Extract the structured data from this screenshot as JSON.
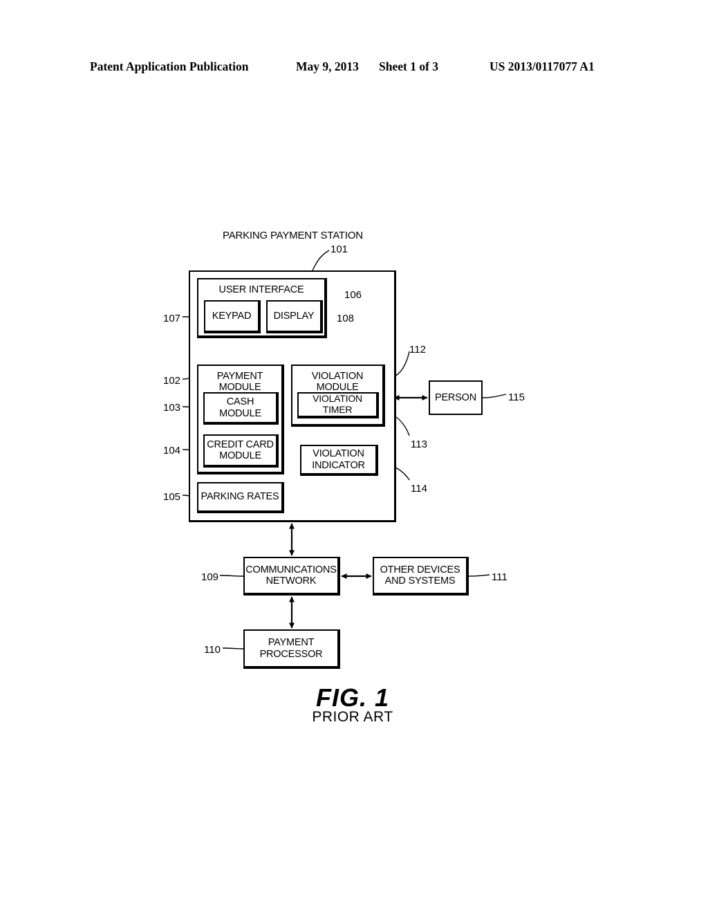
{
  "header": {
    "publication": "Patent Application Publication",
    "date": "May 9, 2013",
    "sheet": "Sheet 1 of 3",
    "number": "US 2013/0117077 A1"
  },
  "figure": {
    "diagram_title": "PARKING PAYMENT STATION",
    "caption_number": "FIG. 1",
    "caption_note": "PRIOR ART",
    "blocks": {
      "station": {
        "label": "",
        "ref": "101"
      },
      "user_interface": {
        "label": "USER INTERFACE",
        "ref": "106"
      },
      "keypad": {
        "label": "KEYPAD",
        "ref": "107"
      },
      "display": {
        "label": "DISPLAY",
        "ref": "108"
      },
      "payment_module": {
        "label": "PAYMENT MODULE",
        "ref": "102"
      },
      "cash_module": {
        "label": "CASH MODULE",
        "ref": "103"
      },
      "credit_card_module": {
        "label": "CREDIT CARD\nMODULE",
        "ref": "104"
      },
      "parking_rates": {
        "label": "PARKING RATES",
        "ref": "105"
      },
      "violation_module": {
        "label": "VIOLATION MODULE",
        "ref": "112"
      },
      "violation_timer": {
        "label": "VIOLATION TIMER",
        "ref": "113"
      },
      "violation_indicator": {
        "label": "VIOLATION\nINDICATOR",
        "ref": "114"
      },
      "person": {
        "label": "PERSON",
        "ref": "115"
      },
      "communications_network": {
        "label": "COMMUNICATIONS\nNETWORK",
        "ref": "109"
      },
      "other_devices": {
        "label": "OTHER DEVICES\nAND SYSTEMS",
        "ref": "111"
      },
      "payment_processor": {
        "label": "PAYMENT\nPROCESSOR",
        "ref": "110"
      }
    },
    "connections": [
      {
        "from": "violation_module",
        "to": "person",
        "type": "bidirectional"
      },
      {
        "from": "station",
        "to": "communications_network",
        "type": "bidirectional"
      },
      {
        "from": "communications_network",
        "to": "other_devices",
        "type": "bidirectional"
      },
      {
        "from": "communications_network",
        "to": "payment_processor",
        "type": "bidirectional"
      }
    ],
    "colors": {
      "ink": "#000000",
      "paper": "#ffffff"
    }
  }
}
